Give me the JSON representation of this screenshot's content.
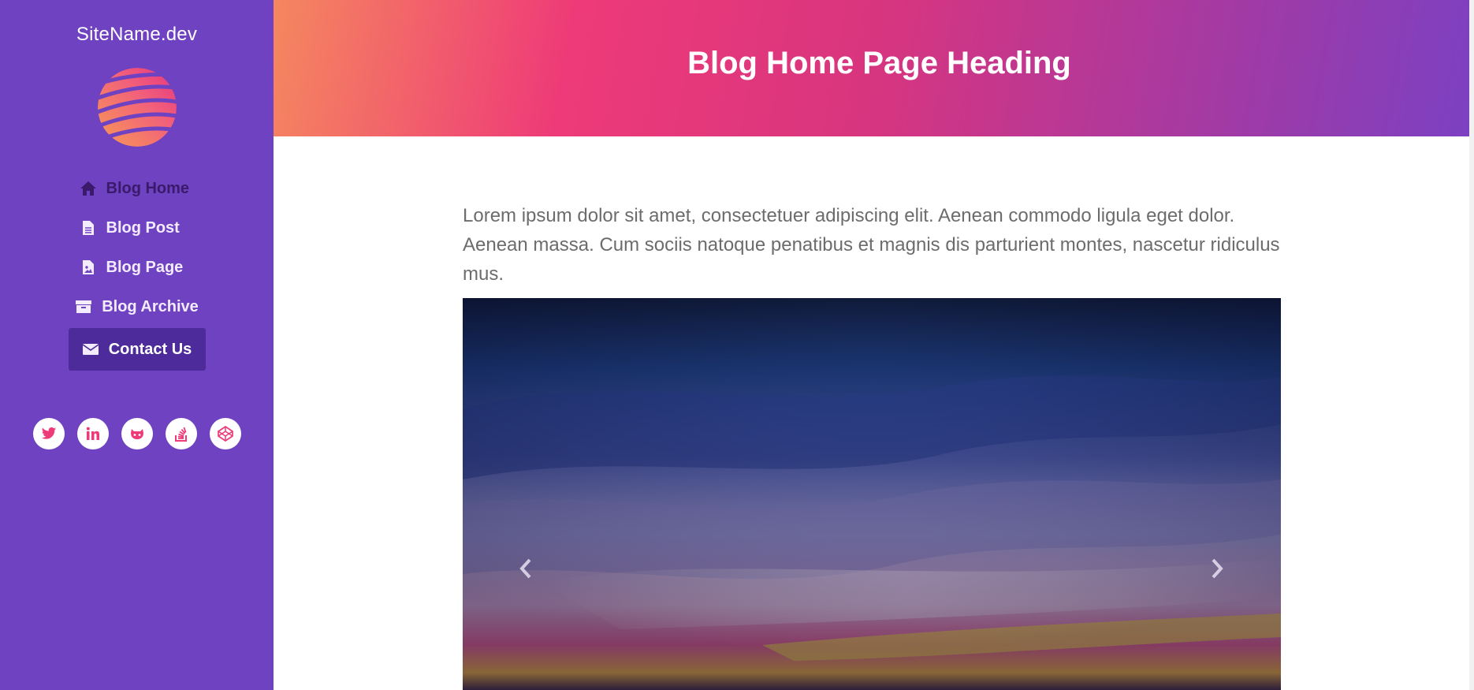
{
  "sidebar": {
    "site_name": "SiteName.dev",
    "logo_icon": "striped-globe-logo",
    "nav": [
      {
        "label": "Blog Home",
        "icon": "home-icon"
      },
      {
        "label": "Blog Post",
        "icon": "file-text-icon"
      },
      {
        "label": "Blog Page",
        "icon": "file-image-icon"
      },
      {
        "label": "Blog Archive",
        "icon": "archive-icon"
      },
      {
        "label": "Contact Us",
        "icon": "envelope-icon",
        "active": true
      }
    ],
    "social": [
      "twitter-icon",
      "linkedin-icon",
      "github-icon",
      "stackoverflow-icon",
      "codepen-icon"
    ]
  },
  "header": {
    "title": "Blog Home Page Heading"
  },
  "main": {
    "intro": "Lorem ipsum dolor sit amet, consectetuer adipiscing elit. Aenean commodo ligula eget dolor. Aenean massa. Cum sociis natoque penatibus et magnis dis parturient montes, nascetur ridiculus mus.",
    "carousel": {
      "prev_icon": "chevron-left-icon",
      "next_icon": "chevron-right-icon"
    }
  },
  "colors": {
    "sidebar": "#6f42c1",
    "active_nav": "#4e2b9a",
    "accent_pink": "#ee3a78",
    "accent_orange": "#f5875f"
  }
}
